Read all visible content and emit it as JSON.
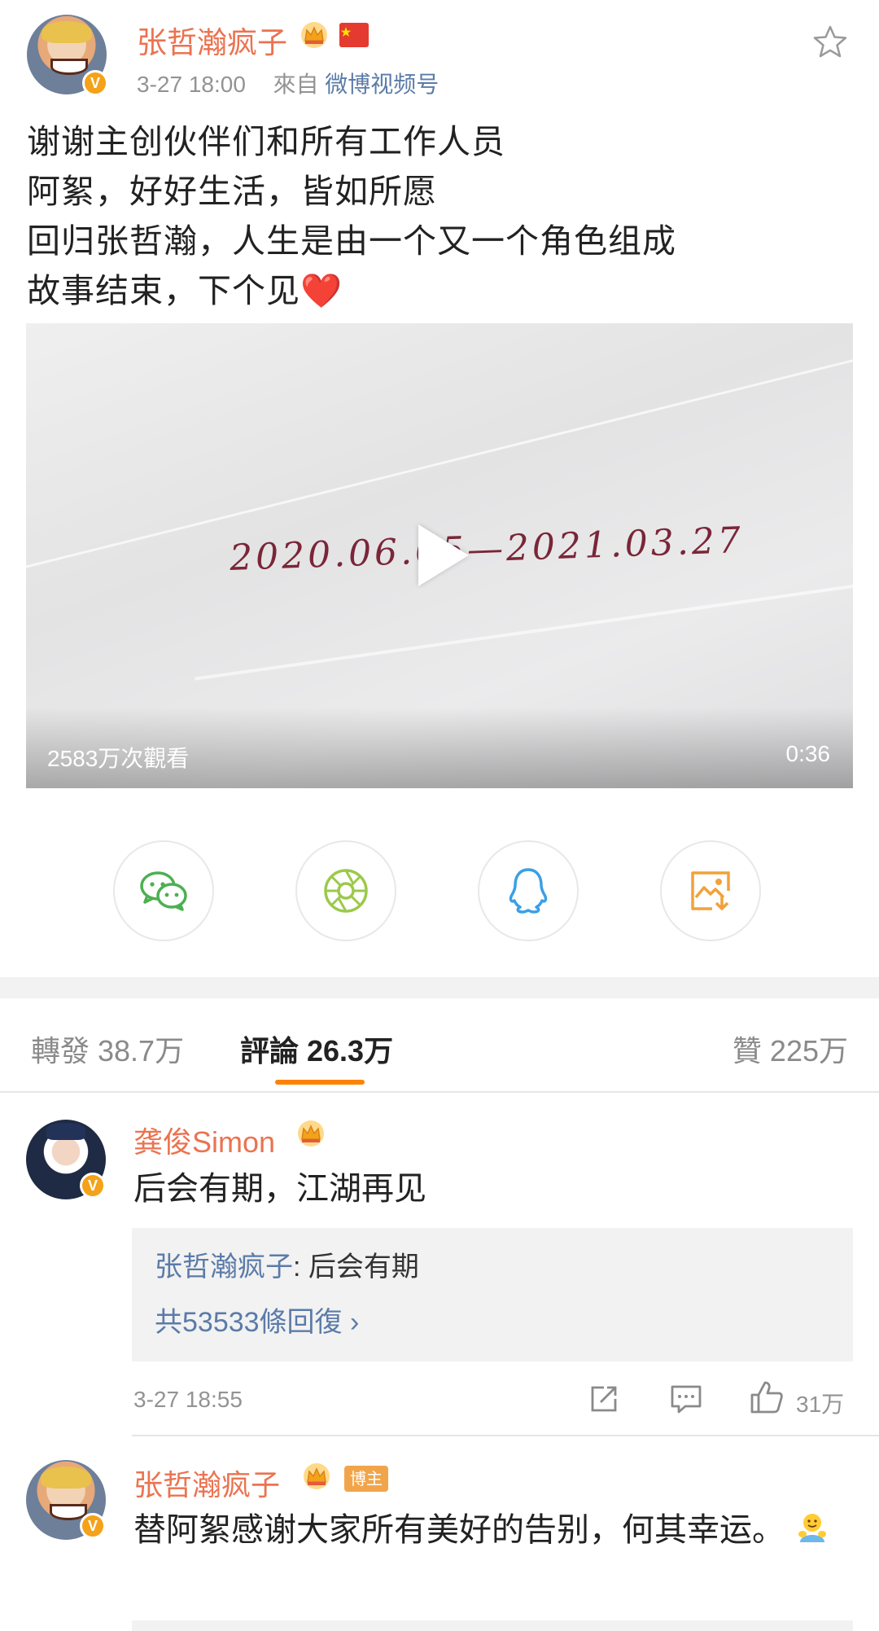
{
  "post": {
    "author": "张哲瀚疯子",
    "time": "3-27 18:00",
    "from_label": "來自",
    "source": "微博视频号",
    "lines": [
      "谢谢主创伙伴们和所有工作人员",
      "阿絮，好好生活，皆如所愿",
      "回归张哲瀚，人生是由一个又一个角色组成",
      "故事结束，下个见❤️"
    ],
    "video": {
      "handwriting": "2020.06.05—2021.03.27",
      "views": "2583万次觀看",
      "duration": "0:36"
    }
  },
  "share": [
    "wechat-icon",
    "moments-icon",
    "qq-icon",
    "save-image-icon"
  ],
  "tabs": {
    "repost": "轉發 38.7万",
    "comments": "評論 26.3万",
    "likes": "贊 225万"
  },
  "comments": [
    {
      "author": "龚俊Simon",
      "text": "后会有期，江湖再见",
      "reply_author": "张哲瀚疯子",
      "reply_sep": ": ",
      "reply_text": "后会有期",
      "reply_count": "共53533條回復 ›",
      "time": "3-27 18:55",
      "likes": "31万"
    },
    {
      "author": "张哲瀚疯子",
      "badge": "博主",
      "text": "替阿絮感谢大家所有美好的告别，何其幸运。"
    }
  ],
  "colors": {
    "name": "#eb7350",
    "link": "#5b7ba8",
    "accent": "#ff8200",
    "meta": "#939393"
  }
}
